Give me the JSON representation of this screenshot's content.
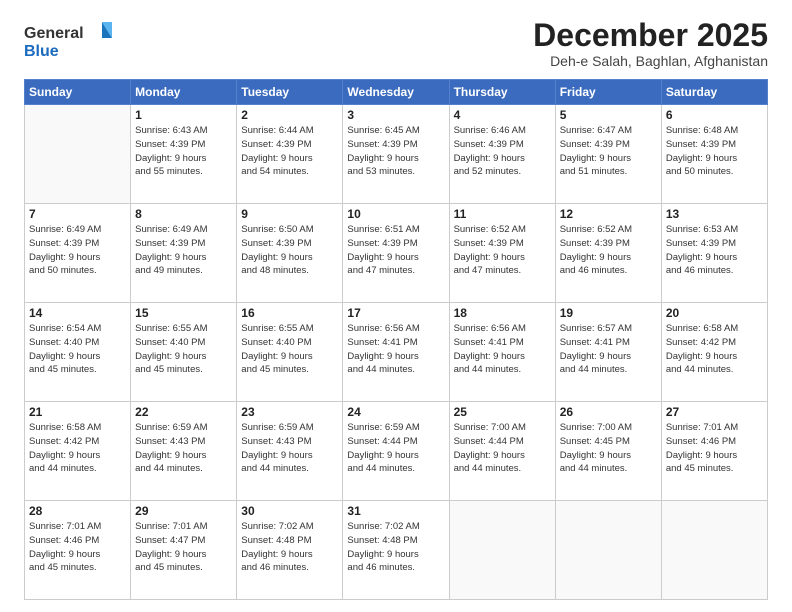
{
  "logo": {
    "general": "General",
    "blue": "Blue"
  },
  "header": {
    "month_title": "December 2025",
    "location": "Deh-e Salah, Baghlan, Afghanistan"
  },
  "days_of_week": [
    "Sunday",
    "Monday",
    "Tuesday",
    "Wednesday",
    "Thursday",
    "Friday",
    "Saturday"
  ],
  "weeks": [
    [
      {
        "day": "",
        "info": ""
      },
      {
        "day": "1",
        "info": "Sunrise: 6:43 AM\nSunset: 4:39 PM\nDaylight: 9 hours\nand 55 minutes."
      },
      {
        "day": "2",
        "info": "Sunrise: 6:44 AM\nSunset: 4:39 PM\nDaylight: 9 hours\nand 54 minutes."
      },
      {
        "day": "3",
        "info": "Sunrise: 6:45 AM\nSunset: 4:39 PM\nDaylight: 9 hours\nand 53 minutes."
      },
      {
        "day": "4",
        "info": "Sunrise: 6:46 AM\nSunset: 4:39 PM\nDaylight: 9 hours\nand 52 minutes."
      },
      {
        "day": "5",
        "info": "Sunrise: 6:47 AM\nSunset: 4:39 PM\nDaylight: 9 hours\nand 51 minutes."
      },
      {
        "day": "6",
        "info": "Sunrise: 6:48 AM\nSunset: 4:39 PM\nDaylight: 9 hours\nand 50 minutes."
      }
    ],
    [
      {
        "day": "7",
        "info": "Sunrise: 6:49 AM\nSunset: 4:39 PM\nDaylight: 9 hours\nand 50 minutes."
      },
      {
        "day": "8",
        "info": "Sunrise: 6:49 AM\nSunset: 4:39 PM\nDaylight: 9 hours\nand 49 minutes."
      },
      {
        "day": "9",
        "info": "Sunrise: 6:50 AM\nSunset: 4:39 PM\nDaylight: 9 hours\nand 48 minutes."
      },
      {
        "day": "10",
        "info": "Sunrise: 6:51 AM\nSunset: 4:39 PM\nDaylight: 9 hours\nand 47 minutes."
      },
      {
        "day": "11",
        "info": "Sunrise: 6:52 AM\nSunset: 4:39 PM\nDaylight: 9 hours\nand 47 minutes."
      },
      {
        "day": "12",
        "info": "Sunrise: 6:52 AM\nSunset: 4:39 PM\nDaylight: 9 hours\nand 46 minutes."
      },
      {
        "day": "13",
        "info": "Sunrise: 6:53 AM\nSunset: 4:39 PM\nDaylight: 9 hours\nand 46 minutes."
      }
    ],
    [
      {
        "day": "14",
        "info": "Sunrise: 6:54 AM\nSunset: 4:40 PM\nDaylight: 9 hours\nand 45 minutes."
      },
      {
        "day": "15",
        "info": "Sunrise: 6:55 AM\nSunset: 4:40 PM\nDaylight: 9 hours\nand 45 minutes."
      },
      {
        "day": "16",
        "info": "Sunrise: 6:55 AM\nSunset: 4:40 PM\nDaylight: 9 hours\nand 45 minutes."
      },
      {
        "day": "17",
        "info": "Sunrise: 6:56 AM\nSunset: 4:41 PM\nDaylight: 9 hours\nand 44 minutes."
      },
      {
        "day": "18",
        "info": "Sunrise: 6:56 AM\nSunset: 4:41 PM\nDaylight: 9 hours\nand 44 minutes."
      },
      {
        "day": "19",
        "info": "Sunrise: 6:57 AM\nSunset: 4:41 PM\nDaylight: 9 hours\nand 44 minutes."
      },
      {
        "day": "20",
        "info": "Sunrise: 6:58 AM\nSunset: 4:42 PM\nDaylight: 9 hours\nand 44 minutes."
      }
    ],
    [
      {
        "day": "21",
        "info": "Sunrise: 6:58 AM\nSunset: 4:42 PM\nDaylight: 9 hours\nand 44 minutes."
      },
      {
        "day": "22",
        "info": "Sunrise: 6:59 AM\nSunset: 4:43 PM\nDaylight: 9 hours\nand 44 minutes."
      },
      {
        "day": "23",
        "info": "Sunrise: 6:59 AM\nSunset: 4:43 PM\nDaylight: 9 hours\nand 44 minutes."
      },
      {
        "day": "24",
        "info": "Sunrise: 6:59 AM\nSunset: 4:44 PM\nDaylight: 9 hours\nand 44 minutes."
      },
      {
        "day": "25",
        "info": "Sunrise: 7:00 AM\nSunset: 4:44 PM\nDaylight: 9 hours\nand 44 minutes."
      },
      {
        "day": "26",
        "info": "Sunrise: 7:00 AM\nSunset: 4:45 PM\nDaylight: 9 hours\nand 44 minutes."
      },
      {
        "day": "27",
        "info": "Sunrise: 7:01 AM\nSunset: 4:46 PM\nDaylight: 9 hours\nand 45 minutes."
      }
    ],
    [
      {
        "day": "28",
        "info": "Sunrise: 7:01 AM\nSunset: 4:46 PM\nDaylight: 9 hours\nand 45 minutes."
      },
      {
        "day": "29",
        "info": "Sunrise: 7:01 AM\nSunset: 4:47 PM\nDaylight: 9 hours\nand 45 minutes."
      },
      {
        "day": "30",
        "info": "Sunrise: 7:02 AM\nSunset: 4:48 PM\nDaylight: 9 hours\nand 46 minutes."
      },
      {
        "day": "31",
        "info": "Sunrise: 7:02 AM\nSunset: 4:48 PM\nDaylight: 9 hours\nand 46 minutes."
      },
      {
        "day": "",
        "info": ""
      },
      {
        "day": "",
        "info": ""
      },
      {
        "day": "",
        "info": ""
      }
    ]
  ]
}
